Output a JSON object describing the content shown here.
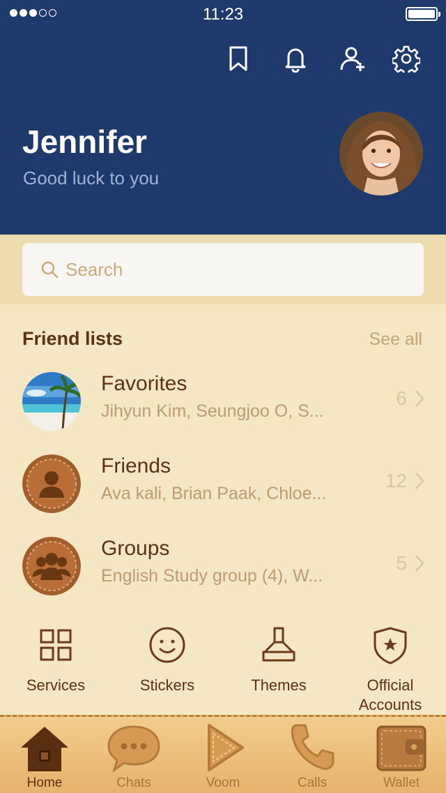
{
  "status_bar": {
    "time": "11:23"
  },
  "profile": {
    "name": "Jennifer",
    "status": "Good luck to you"
  },
  "header_icons": [
    "bookmark-icon",
    "bell-icon",
    "add-friend-icon",
    "gear-icon"
  ],
  "search": {
    "placeholder": "Search"
  },
  "friend_lists": {
    "title": "Friend lists",
    "see_all": "See all",
    "items": [
      {
        "title": "Favorites",
        "members": "Jihyun Kim, Seungjoo O, S...",
        "count": "6"
      },
      {
        "title": "Friends",
        "members": "Ava kali, Brian Paak, Chloe...",
        "count": "12"
      },
      {
        "title": "Groups",
        "members": "English Study group (4), W...",
        "count": "5"
      }
    ]
  },
  "quick_menu": [
    {
      "label": "Services",
      "icon": "grid-icon"
    },
    {
      "label": "Stickers",
      "icon": "smiley-icon"
    },
    {
      "label": "Themes",
      "icon": "brush-icon"
    },
    {
      "label": "Official Accounts",
      "icon": "shield-star-icon"
    }
  ],
  "tabs": [
    {
      "label": "Home",
      "icon": "home-icon",
      "active": true
    },
    {
      "label": "Chats",
      "icon": "chat-bubble-icon"
    },
    {
      "label": "Voom",
      "icon": "play-icon"
    },
    {
      "label": "Calls",
      "icon": "phone-icon"
    },
    {
      "label": "Wallet",
      "icon": "wallet-icon"
    }
  ],
  "colors": {
    "header_bg": "#1e3a6d",
    "body_bg": "#f5e6c4",
    "accent_brown": "#5a3314",
    "muted_tan": "#bc9c70"
  }
}
